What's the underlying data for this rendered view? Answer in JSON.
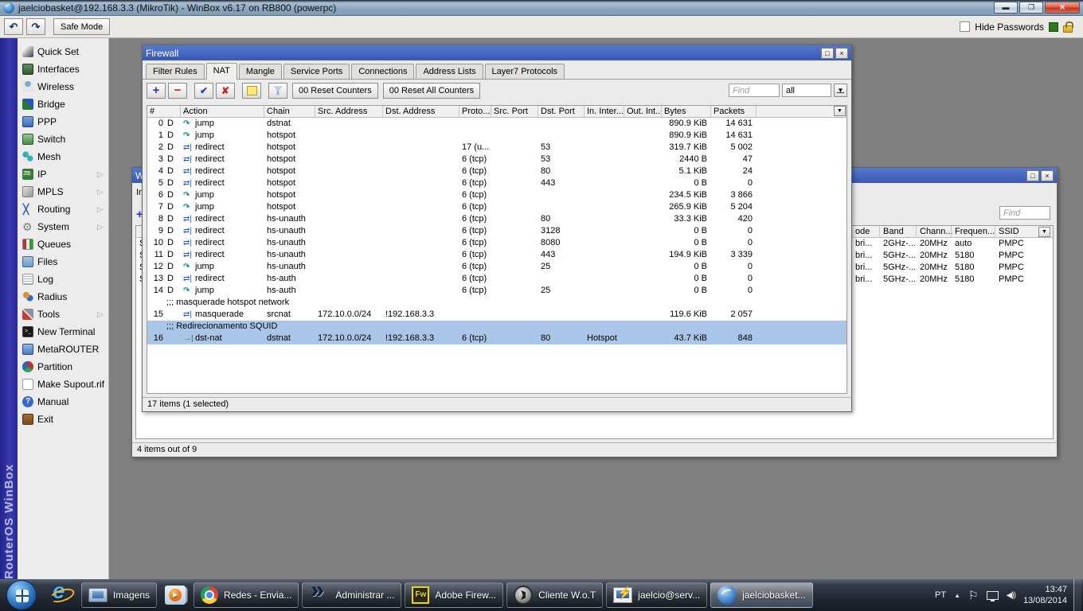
{
  "window": {
    "title": "jaelciobasket@192.168.3.3 (MikroTik) - WinBox v6.17 on RB800 (powerpc)",
    "brand": "RouterOS WinBox",
    "toolbar": {
      "safe_mode": "Safe Mode",
      "hide_passwords": "Hide Passwords"
    }
  },
  "sidebar": {
    "items": [
      {
        "label": "Quick Set",
        "icon": "quickset-icon"
      },
      {
        "label": "Interfaces",
        "icon": "interfaces-icon"
      },
      {
        "label": "Wireless",
        "icon": "wireless-icon"
      },
      {
        "label": "Bridge",
        "icon": "bridge-icon"
      },
      {
        "label": "PPP",
        "icon": "ppp-icon"
      },
      {
        "label": "Switch",
        "icon": "switch-icon"
      },
      {
        "label": "Mesh",
        "icon": "mesh-icon"
      },
      {
        "label": "IP",
        "icon": "ip-icon",
        "submenu": true
      },
      {
        "label": "MPLS",
        "icon": "mpls-icon",
        "submenu": true
      },
      {
        "label": "Routing",
        "icon": "routing-icon",
        "submenu": true
      },
      {
        "label": "System",
        "icon": "system-icon",
        "submenu": true
      },
      {
        "label": "Queues",
        "icon": "queues-icon"
      },
      {
        "label": "Files",
        "icon": "files-icon"
      },
      {
        "label": "Log",
        "icon": "log-icon"
      },
      {
        "label": "Radius",
        "icon": "radius-icon"
      },
      {
        "label": "Tools",
        "icon": "tools-icon",
        "submenu": true
      },
      {
        "label": "New Terminal",
        "icon": "terminal-icon"
      },
      {
        "label": "MetaROUTER",
        "icon": "metarouter-icon"
      },
      {
        "label": "Partition",
        "icon": "partition-icon"
      },
      {
        "label": "Make Supout.rif",
        "icon": "supout-icon"
      },
      {
        "label": "Manual",
        "icon": "manual-icon"
      },
      {
        "label": "Exit",
        "icon": "exit-icon"
      }
    ]
  },
  "firewall": {
    "title": "Firewall",
    "tabs": [
      "Filter Rules",
      "NAT",
      "Mangle",
      "Service Ports",
      "Connections",
      "Address Lists",
      "Layer7 Protocols"
    ],
    "active_tab": "NAT",
    "toolbar": {
      "reset_counters": "00  Reset Counters",
      "reset_all_counters": "00  Reset All Counters",
      "find_placeholder": "Find",
      "filter_value": "all"
    },
    "columns": [
      "#",
      "Action",
      "Chain",
      "Src. Address",
      "Dst. Address",
      "Proto...",
      "Src. Port",
      "Dst. Port",
      "In. Inter...",
      "Out. Int...",
      "Bytes",
      "Packets"
    ],
    "rows": [
      {
        "num": "0",
        "flag": "D",
        "action": "jump",
        "chain": "dstnat",
        "bytes": "890.9 KiB",
        "packets": "14 631"
      },
      {
        "num": "1",
        "flag": "D",
        "action": "jump",
        "chain": "hotspot",
        "bytes": "890.9 KiB",
        "packets": "14 631"
      },
      {
        "num": "2",
        "flag": "D",
        "action": "redirect",
        "chain": "hotspot",
        "proto": "17 (u...",
        "dport": "53",
        "bytes": "319.7 KiB",
        "packets": "5 002"
      },
      {
        "num": "3",
        "flag": "D",
        "action": "redirect",
        "chain": "hotspot",
        "proto": "6 (tcp)",
        "dport": "53",
        "bytes": "2440 B",
        "packets": "47"
      },
      {
        "num": "4",
        "flag": "D",
        "action": "redirect",
        "chain": "hotspot",
        "proto": "6 (tcp)",
        "dport": "80",
        "bytes": "5.1 KiB",
        "packets": "24"
      },
      {
        "num": "5",
        "flag": "D",
        "action": "redirect",
        "chain": "hotspot",
        "proto": "6 (tcp)",
        "dport": "443",
        "bytes": "0 B",
        "packets": "0"
      },
      {
        "num": "6",
        "flag": "D",
        "action": "jump",
        "chain": "hotspot",
        "proto": "6 (tcp)",
        "bytes": "234.5 KiB",
        "packets": "3 866"
      },
      {
        "num": "7",
        "flag": "D",
        "action": "jump",
        "chain": "hotspot",
        "proto": "6 (tcp)",
        "bytes": "265.9 KiB",
        "packets": "5 204"
      },
      {
        "num": "8",
        "flag": "D",
        "action": "redirect",
        "chain": "hs-unauth",
        "proto": "6 (tcp)",
        "dport": "80",
        "bytes": "33.3 KiB",
        "packets": "420"
      },
      {
        "num": "9",
        "flag": "D",
        "action": "redirect",
        "chain": "hs-unauth",
        "proto": "6 (tcp)",
        "dport": "3128",
        "bytes": "0 B",
        "packets": "0"
      },
      {
        "num": "10",
        "flag": "D",
        "action": "redirect",
        "chain": "hs-unauth",
        "proto": "6 (tcp)",
        "dport": "8080",
        "bytes": "0 B",
        "packets": "0"
      },
      {
        "num": "11",
        "flag": "D",
        "action": "redirect",
        "chain": "hs-unauth",
        "proto": "6 (tcp)",
        "dport": "443",
        "bytes": "194.9 KiB",
        "packets": "3 339"
      },
      {
        "num": "12",
        "flag": "D",
        "action": "jump",
        "chain": "hs-unauth",
        "proto": "6 (tcp)",
        "dport": "25",
        "bytes": "0 B",
        "packets": "0"
      },
      {
        "num": "13",
        "flag": "D",
        "action": "redirect",
        "chain": "hs-auth",
        "proto": "6 (tcp)",
        "bytes": "0 B",
        "packets": "0"
      },
      {
        "num": "14",
        "flag": "D",
        "action": "jump",
        "chain": "hs-auth",
        "proto": "6 (tcp)",
        "dport": "25",
        "bytes": "0 B",
        "packets": "0"
      },
      {
        "comment": ";;; masquerade hotspot network"
      },
      {
        "num": "15",
        "action": "masquerade",
        "chain": "srcnat",
        "src": "172.10.0.0/24",
        "dst": "!192.168.3.3",
        "bytes": "119.6 KiB",
        "packets": "2 057"
      },
      {
        "comment": ";;; Redirecionamento SQUID",
        "selected": true
      },
      {
        "num": "16",
        "action": "dst-nat",
        "chain": "dstnat",
        "src": "172.10.0.0/24",
        "dst": "!192.168.3.3",
        "proto": "6 (tcp)",
        "dport": "80",
        "inif": "Hotspot",
        "bytes": "43.7 KiB",
        "packets": "848",
        "selected": true
      }
    ],
    "status": "17 items (1 selected)"
  },
  "wireless": {
    "title_fragment": "W",
    "tab_fragment": "In",
    "find_placeholder": "Find",
    "columns": [
      "ode",
      "Band",
      "Chann...",
      "Frequen...",
      "SSID"
    ],
    "rows": [
      {
        "flag": "S",
        "mode": "bri...",
        "band": "2GHz-...",
        "width": "20MHz",
        "freq": "auto",
        "ssid": "PMPC"
      },
      {
        "flag": "S",
        "mode": "bri...",
        "band": "5GHz-...",
        "width": "20MHz",
        "freq": "5180",
        "ssid": "PMPC"
      },
      {
        "flag": "S",
        "mode": "bri...",
        "band": "5GHz-...",
        "width": "20MHz",
        "freq": "5180",
        "ssid": "PMPC"
      },
      {
        "flag": "S",
        "mode": "bri...",
        "band": "5GHz-...",
        "width": "20MHz",
        "freq": "5180",
        "ssid": "PMPC"
      }
    ],
    "status": "4 items out of 9"
  },
  "taskbar": {
    "items": [
      {
        "label": "Imagens",
        "icon": "image-viewer-icon"
      },
      {
        "label": "",
        "icon": "media-player-icon"
      },
      {
        "label": "Redes - Envia...",
        "icon": "chrome-icon"
      },
      {
        "label": "Administrar ...",
        "icon": "remote-admin-icon"
      },
      {
        "label": "Adobe Firew...",
        "icon": "adobe-fireworks-icon"
      },
      {
        "label": "Cliente W.o.T",
        "icon": "wot-icon"
      },
      {
        "label": "jaelcio@serv...",
        "icon": "winbox-loader-icon"
      },
      {
        "label": "jaelciobasket...",
        "icon": "winbox-icon",
        "active": true
      }
    ],
    "tray": {
      "lang": "PT",
      "time": "13:47",
      "date": "13/08/2014"
    }
  }
}
